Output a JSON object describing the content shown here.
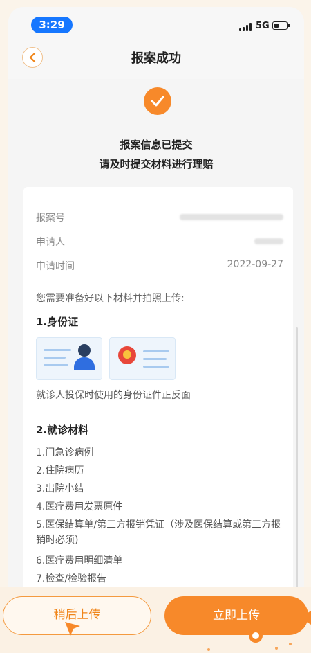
{
  "status_bar": {
    "time": "3:29",
    "network": "5G",
    "battery_level": 0.4
  },
  "header": {
    "title": "报案成功",
    "back_icon": "chevron-left-icon"
  },
  "success": {
    "icon": "check-icon",
    "line1": "报案信息已提交",
    "line2": "请及时提交材料进行理赔"
  },
  "info": {
    "rows": [
      {
        "label": "报案号",
        "value": ""
      },
      {
        "label": "申请人",
        "value": ""
      },
      {
        "label": "申请时间",
        "value": "2022-09-27"
      }
    ]
  },
  "materials": {
    "intro": "您需要准备好以下材料并拍照上传:",
    "section1": {
      "title": "1.身份证",
      "description": "就诊人投保时使用的身份证件正反面"
    },
    "section2": {
      "title": "2.就诊材料",
      "items": [
        "1.门急诊病例",
        "2.住院病历",
        "3.出院小结",
        "4.医疗费用发票原件",
        "5.医保结算单/第三方报销凭证（涉及医保结算或第三方报销时必须)",
        "6.医疗费用明细清单",
        "7.检查/检验报告"
      ]
    }
  },
  "actions": {
    "later_label": "稍后上传",
    "now_label": "立即上传"
  },
  "colors": {
    "accent": "#f7892a",
    "blue": "#1677ff"
  }
}
